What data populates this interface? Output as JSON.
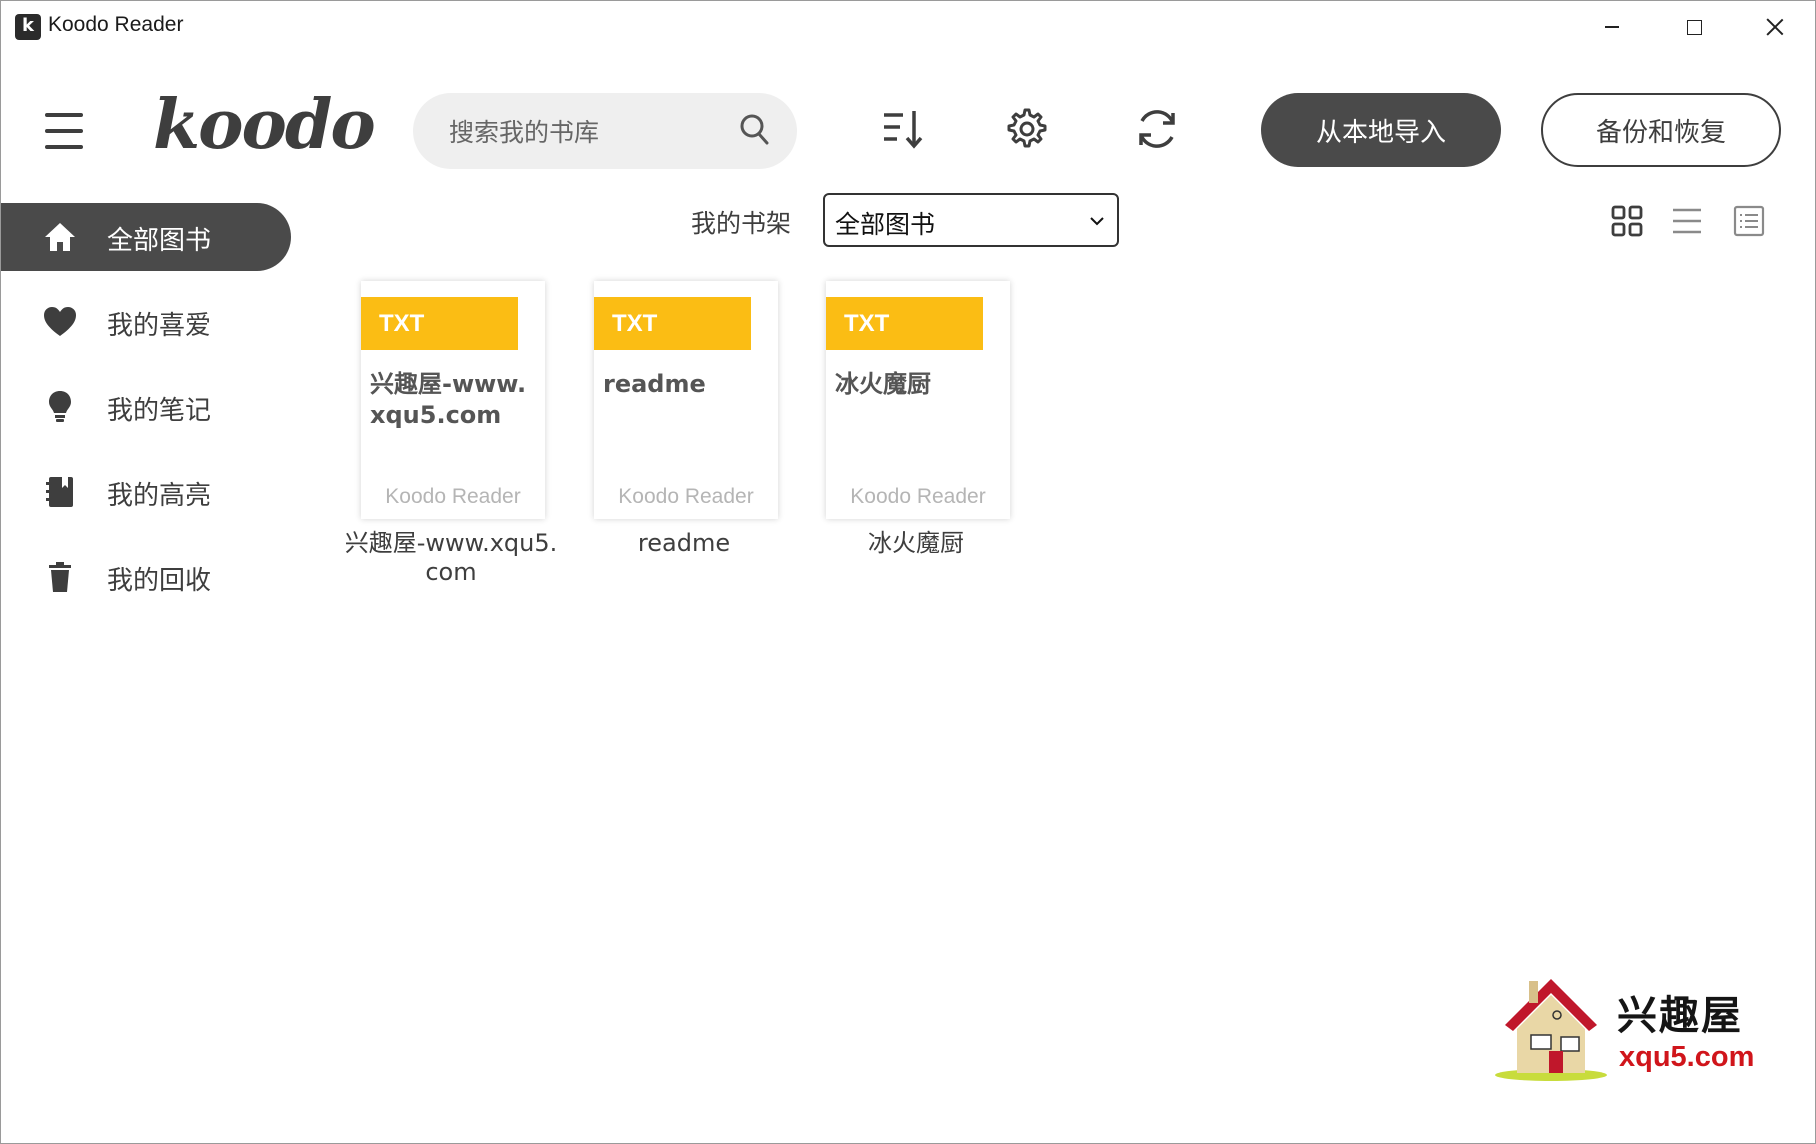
{
  "window": {
    "title": "Koodo Reader"
  },
  "header": {
    "logo": "koodo",
    "search_placeholder": "搜索我的书库",
    "import_label": "从本地导入",
    "backup_label": "备份和恢复"
  },
  "sidebar": {
    "items": [
      {
        "label": "全部图书",
        "icon": "home-icon"
      },
      {
        "label": "我的喜爱",
        "icon": "heart-icon"
      },
      {
        "label": "我的笔记",
        "icon": "lightbulb-icon"
      },
      {
        "label": "我的高亮",
        "icon": "notebook-icon"
      },
      {
        "label": "我的回收",
        "icon": "trash-icon"
      }
    ]
  },
  "shelf": {
    "label": "我的书架",
    "selected": "全部图书"
  },
  "books": [
    {
      "format": "TXT",
      "cover_title": "兴趣屋-www.xqu5.com",
      "cover_footer": "Koodo Reader",
      "name": "兴趣屋-www.xqu5.com"
    },
    {
      "format": "TXT",
      "cover_title": "readme",
      "cover_footer": "Koodo Reader",
      "name": "readme"
    },
    {
      "format": "TXT",
      "cover_title": "冰火魔厨",
      "cover_footer": "Koodo Reader",
      "name": "冰火魔厨"
    }
  ],
  "watermark": {
    "name": "兴趣屋",
    "domain": "xqu5.com"
  },
  "colors": {
    "accent_dark": "#4a4a4a",
    "tag_yellow": "#fbbd14",
    "watermark_red": "#d0151b"
  }
}
